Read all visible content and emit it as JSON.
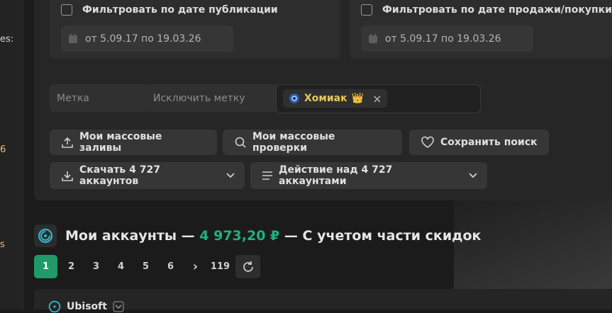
{
  "left_rail": {
    "text_a": "es:",
    "text_b": "6",
    "text_c": "s"
  },
  "filters": {
    "publication": {
      "label": "Фильтровать по дате публикации",
      "date_range": "от 5.09.17 по 19.03.26",
      "checked": false
    },
    "sale": {
      "label": "Фильтровать по дате продажи/покупки",
      "date_range": "от 5.09.17 по 19.03.26",
      "checked": false
    }
  },
  "tags": {
    "include_placeholder": "Метка",
    "exclude_placeholder": "Исключить метку",
    "selected": [
      {
        "label": "Хомиак",
        "emoji": "👑",
        "remove_glyph": "×"
      }
    ]
  },
  "actions": {
    "mass_uploads": "Мои массовые заливы",
    "mass_checks": "Мои массовые проверки",
    "save_search": "Сохранить поиск",
    "download": "Скачать 4 727 аккаунтов",
    "bulk_action": "Действие над 4 727 аккаунтами"
  },
  "accounts": {
    "title": "Мои аккаунты —",
    "price": "4 973,20 ₽",
    "suffix": "— С учетом части скидок"
  },
  "pagination": {
    "pages": [
      "1",
      "2",
      "3",
      "4",
      "5",
      "6"
    ],
    "next": "›",
    "last": "119",
    "current": "1"
  },
  "bottom": {
    "label": "Ubisoft"
  },
  "colors": {
    "accent": "#1f9a68",
    "price": "#1fb37a",
    "tag": "#e8c75a",
    "panel": "#262626"
  }
}
